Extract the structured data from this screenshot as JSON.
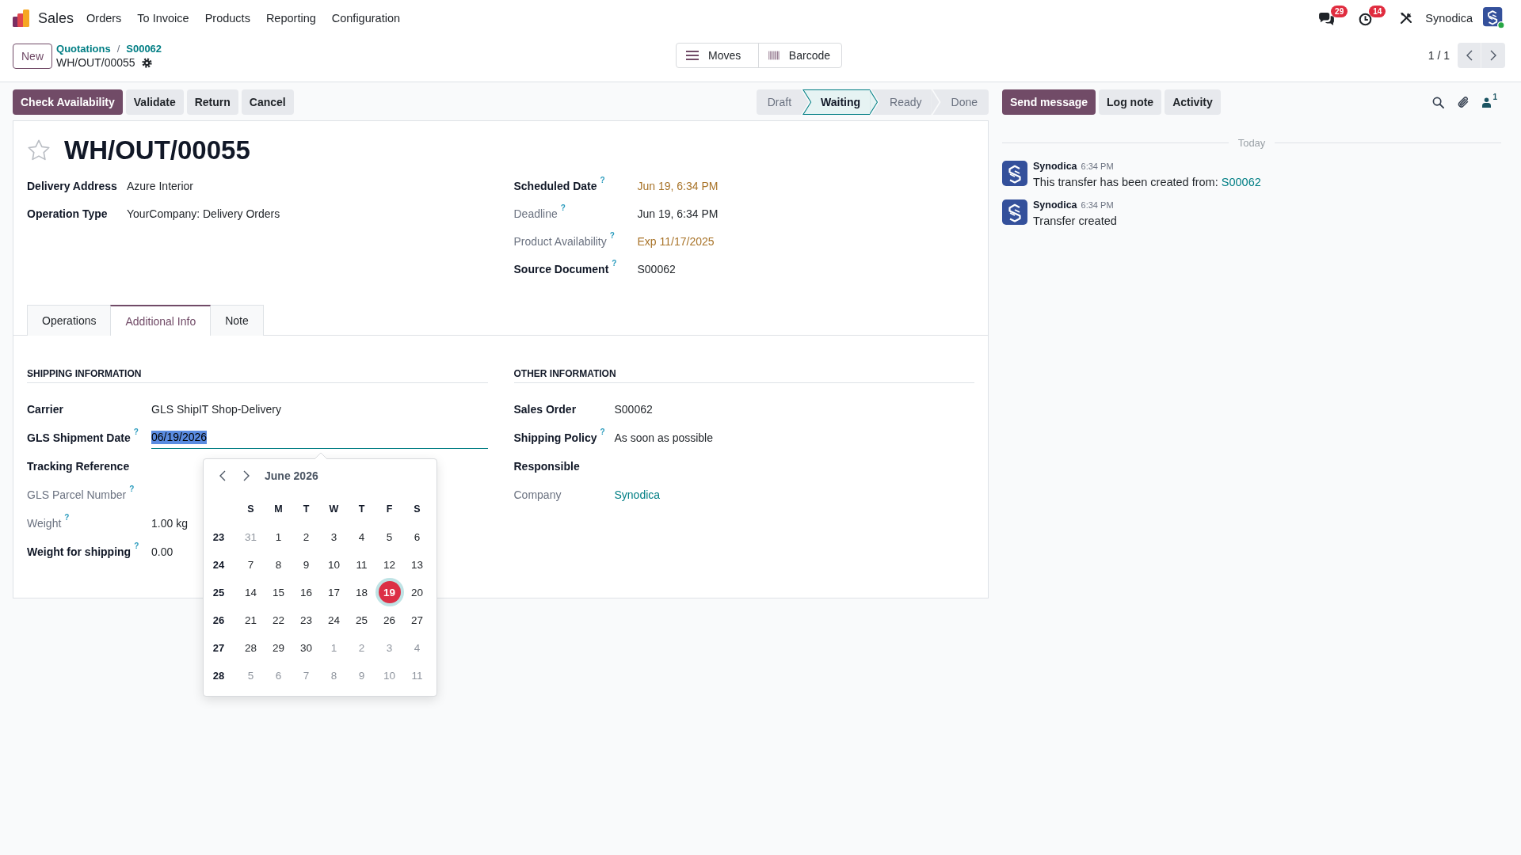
{
  "navbar": {
    "app_name": "Sales",
    "menu": [
      "Orders",
      "To Invoice",
      "Products",
      "Reporting",
      "Configuration"
    ],
    "messages_badge": "29",
    "activities_badge": "14",
    "company": "Synodica",
    "online": true
  },
  "control_panel": {
    "new_button": "New",
    "breadcrumbs": [
      "Quotations",
      "S00062"
    ],
    "separator": "/",
    "record_name": "WH/OUT/00055",
    "view_buttons": [
      {
        "label": "Moves",
        "kind": "moves"
      },
      {
        "label": "Barcode",
        "kind": "barcode"
      }
    ],
    "pager": "1 / 1"
  },
  "actions": [
    {
      "label": "Check Availability",
      "primary": true
    },
    {
      "label": "Validate",
      "primary": false
    },
    {
      "label": "Return",
      "primary": false
    },
    {
      "label": "Cancel",
      "primary": false
    }
  ],
  "status_steps": [
    {
      "label": "Draft",
      "selected": false
    },
    {
      "label": "Waiting",
      "selected": true
    },
    {
      "label": "Ready",
      "selected": false
    },
    {
      "label": "Done",
      "selected": false
    }
  ],
  "form": {
    "starred": false,
    "title": "WH/OUT/00055",
    "left_fields": [
      {
        "label": "Delivery Address",
        "readonly": false,
        "kind": "text",
        "value": "Azure Interior"
      },
      {
        "label": "Operation Type",
        "readonly": false,
        "kind": "text",
        "value": "YourCompany: Delivery Orders"
      }
    ],
    "right_fields": [
      {
        "label": "Scheduled Date",
        "help": "?",
        "readonly": false,
        "kind": "warning",
        "value": "Jun 19, 6:34 PM"
      },
      {
        "label": "Deadline",
        "help": "?",
        "readonly": true,
        "kind": "text",
        "value": "Jun 19, 6:34 PM"
      },
      {
        "label": "Product Availability",
        "help": "?",
        "readonly": true,
        "kind": "warning",
        "value": "Exp 11/17/2025"
      },
      {
        "label": "Source Document",
        "help": "?",
        "readonly": false,
        "kind": "text",
        "value": "S00062"
      }
    ],
    "tabs": [
      {
        "label": "Operations",
        "selected": false
      },
      {
        "label": "Additional Info",
        "selected": true
      },
      {
        "label": "Note",
        "selected": false
      }
    ],
    "sections": [
      {
        "title": "SHIPPING INFORMATION",
        "fields": [
          {
            "label": "Carrier",
            "readonly": false,
            "kind": "text",
            "value": "GLS ShipIT Shop-Delivery"
          },
          {
            "label": "GLS Shipment Date",
            "help": "?",
            "readonly": false,
            "kind": "date_input",
            "value": "06/19/2026",
            "focused": true,
            "text_selected": true
          },
          {
            "label": "Tracking Reference",
            "readonly": false,
            "kind": "text"
          },
          {
            "label": "GLS Parcel Number",
            "help": "?",
            "readonly": true,
            "kind": "text"
          },
          {
            "label": "Weight",
            "help": "?",
            "readonly": true,
            "kind": "text",
            "value": "1.00 kg"
          },
          {
            "label": "Weight for shipping",
            "help": "?",
            "readonly": false,
            "kind": "text",
            "value": "0.00"
          }
        ]
      },
      {
        "title": "OTHER INFORMATION",
        "fields": [
          {
            "label": "Sales Order",
            "readonly": false,
            "kind": "text",
            "value": "S00062"
          },
          {
            "label": "Shipping Policy",
            "help": "?",
            "readonly": false,
            "kind": "text",
            "value": "As soon as possible"
          },
          {
            "label": "Responsible",
            "readonly": false,
            "kind": "text"
          },
          {
            "label": "Company",
            "readonly": true,
            "kind": "link",
            "value": "Synodica"
          }
        ]
      }
    ]
  },
  "date_picker": {
    "month_label": "June 2026",
    "weekdays": [
      "S",
      "M",
      "T",
      "W",
      "T",
      "F",
      "S"
    ],
    "weeks": [
      {
        "number": "23",
        "days": [
          {
            "label": "31",
            "other_month": true,
            "selected": false
          },
          {
            "label": "1",
            "other_month": false,
            "selected": false
          },
          {
            "label": "2",
            "other_month": false,
            "selected": false
          },
          {
            "label": "3",
            "other_month": false,
            "selected": false
          },
          {
            "label": "4",
            "other_month": false,
            "selected": false
          },
          {
            "label": "5",
            "other_month": false,
            "selected": false
          },
          {
            "label": "6",
            "other_month": false,
            "selected": false
          }
        ]
      },
      {
        "number": "24",
        "days": [
          {
            "label": "7",
            "other_month": false,
            "selected": false
          },
          {
            "label": "8",
            "other_month": false,
            "selected": false
          },
          {
            "label": "9",
            "other_month": false,
            "selected": false
          },
          {
            "label": "10",
            "other_month": false,
            "selected": false
          },
          {
            "label": "11",
            "other_month": false,
            "selected": false
          },
          {
            "label": "12",
            "other_month": false,
            "selected": false
          },
          {
            "label": "13",
            "other_month": false,
            "selected": false
          }
        ]
      },
      {
        "number": "25",
        "days": [
          {
            "label": "14",
            "other_month": false,
            "selected": false
          },
          {
            "label": "15",
            "other_month": false,
            "selected": false
          },
          {
            "label": "16",
            "other_month": false,
            "selected": false
          },
          {
            "label": "17",
            "other_month": false,
            "selected": false
          },
          {
            "label": "18",
            "other_month": false,
            "selected": false
          },
          {
            "label": "19",
            "other_month": false,
            "selected": true
          },
          {
            "label": "20",
            "other_month": false,
            "selected": false
          }
        ]
      },
      {
        "number": "26",
        "days": [
          {
            "label": "21",
            "other_month": false,
            "selected": false
          },
          {
            "label": "22",
            "other_month": false,
            "selected": false
          },
          {
            "label": "23",
            "other_month": false,
            "selected": false
          },
          {
            "label": "24",
            "other_month": false,
            "selected": false
          },
          {
            "label": "25",
            "other_month": false,
            "selected": false
          },
          {
            "label": "26",
            "other_month": false,
            "selected": false
          },
          {
            "label": "27",
            "other_month": false,
            "selected": false
          }
        ]
      },
      {
        "number": "27",
        "days": [
          {
            "label": "28",
            "other_month": false,
            "selected": false
          },
          {
            "label": "29",
            "other_month": false,
            "selected": false
          },
          {
            "label": "30",
            "other_month": false,
            "selected": false
          },
          {
            "label": "1",
            "other_month": true,
            "selected": false
          },
          {
            "label": "2",
            "other_month": true,
            "selected": false
          },
          {
            "label": "3",
            "other_month": true,
            "selected": false
          },
          {
            "label": "4",
            "other_month": true,
            "selected": false
          }
        ]
      },
      {
        "number": "28",
        "days": [
          {
            "label": "5",
            "other_month": true,
            "selected": false
          },
          {
            "label": "6",
            "other_month": true,
            "selected": false
          },
          {
            "label": "7",
            "other_month": true,
            "selected": false
          },
          {
            "label": "8",
            "other_month": true,
            "selected": false
          },
          {
            "label": "9",
            "other_month": true,
            "selected": false
          },
          {
            "label": "10",
            "other_month": true,
            "selected": false
          },
          {
            "label": "11",
            "other_month": true,
            "selected": false
          }
        ]
      }
    ]
  },
  "chatter": {
    "buttons": [
      {
        "label": "Send message",
        "primary": true
      },
      {
        "label": "Log note",
        "primary": false
      },
      {
        "label": "Activity",
        "primary": false
      }
    ],
    "followers": "1",
    "date_separator": "Today",
    "messages": [
      {
        "author": "Synodica",
        "time": "6:34 PM",
        "body": "This transfer has been created from:",
        "link": "S00062"
      },
      {
        "author": "Synodica",
        "time": "6:34 PM",
        "body": "Transfer created"
      }
    ]
  }
}
